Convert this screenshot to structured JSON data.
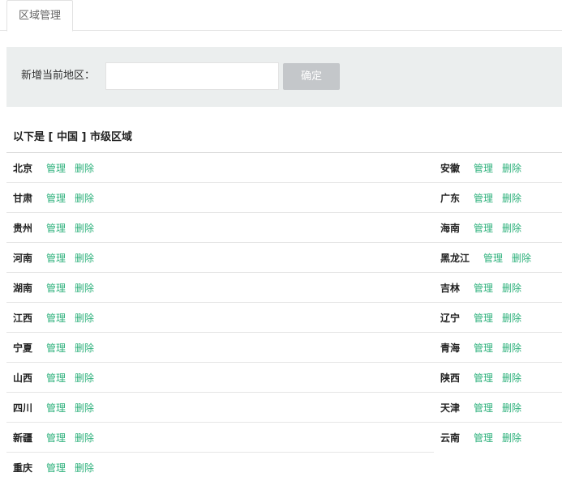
{
  "tab": {
    "label": "区域管理"
  },
  "add_form": {
    "label": "新增当前地区：",
    "input_value": "",
    "input_placeholder": "",
    "confirm_label": "确定"
  },
  "list": {
    "title": "以下是 [ 中国 ] 市级区域",
    "manage_label": "管理",
    "delete_label": "删除",
    "left": [
      "北京",
      "甘肃",
      "贵州",
      "河南",
      "湖南",
      "江西",
      "宁夏",
      "山西",
      "四川",
      "新疆",
      "重庆"
    ],
    "right": [
      "安徽",
      "广东",
      "海南",
      "黑龙江",
      "吉林",
      "辽宁",
      "青海",
      "陕西",
      "天津",
      "云南"
    ]
  },
  "colors": {
    "action_link": "#2bb07a",
    "confirm_button": "#c4c7ca",
    "add_bar_background": "#ebeeee"
  }
}
